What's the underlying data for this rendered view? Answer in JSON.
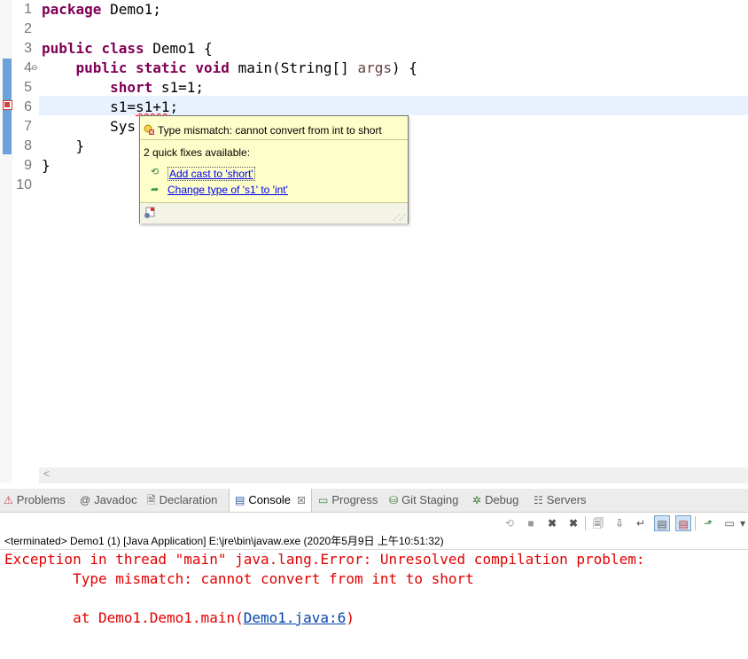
{
  "editor": {
    "line_numbers": [
      "1",
      "2",
      "3",
      "4",
      "5",
      "6",
      "7",
      "8",
      "9",
      "10"
    ],
    "lines": {
      "l1_kw": "package",
      "l1_rest": " Demo1;",
      "l3_kw1": "public",
      "l3_kw2": "class",
      "l3_rest": " Demo1 {",
      "l4_kw1": "public",
      "l4_kw2": "static",
      "l4_kw3": "void",
      "l4_mid": " main(String[] ",
      "l4_param": "args",
      "l4_end": ") {",
      "l5_kw": "short",
      "l5_rest": " s1=1;",
      "l6_pre": "s1=",
      "l6_err": "s1+1",
      "l6_post": ";",
      "l7": "Sys",
      "l8": "}",
      "l9": "}"
    },
    "hscroll_arrow": "<"
  },
  "quickfix": {
    "title": "Type mismatch: cannot convert from int to short",
    "available": "2 quick fixes available:",
    "fixes": [
      {
        "label": "Add cast to 'short'",
        "icon": "cast-icon"
      },
      {
        "label": "Change type of 's1' to 'int'",
        "icon": "change-type-icon"
      }
    ]
  },
  "views": {
    "tabs": [
      {
        "label": "Problems",
        "icon": "problems-icon"
      },
      {
        "label": "Javadoc",
        "icon": "javadoc-icon"
      },
      {
        "label": "Declaration",
        "icon": "declaration-icon"
      },
      {
        "label": "Console",
        "icon": "console-icon",
        "active": true
      },
      {
        "label": "Progress",
        "icon": "progress-icon"
      },
      {
        "label": "Git Staging",
        "icon": "git-staging-icon"
      },
      {
        "label": "Debug",
        "icon": "debug-icon"
      },
      {
        "label": "Servers",
        "icon": "servers-icon"
      }
    ],
    "close_glyph": "☒"
  },
  "console": {
    "terminated": "<terminated> Demo1 (1) [Java Application] E:\\jre\\bin\\javaw.exe (2020年5月9日 上午10:51:32)",
    "line1": "Exception in thread \"main\" java.lang.Error: Unresolved compilation problem: ",
    "line2": "        Type mismatch: cannot convert from int to short",
    "line3_pre": "        at Demo1.Demo1.main(",
    "line3_link": "Demo1.java:6",
    "line3_post": ")"
  },
  "colors": {
    "keyword": "#7f0055",
    "error_text": "#e10000",
    "link": "#0645ad",
    "popup_bg": "#fefecb",
    "current_line": "#e8f2fe"
  }
}
